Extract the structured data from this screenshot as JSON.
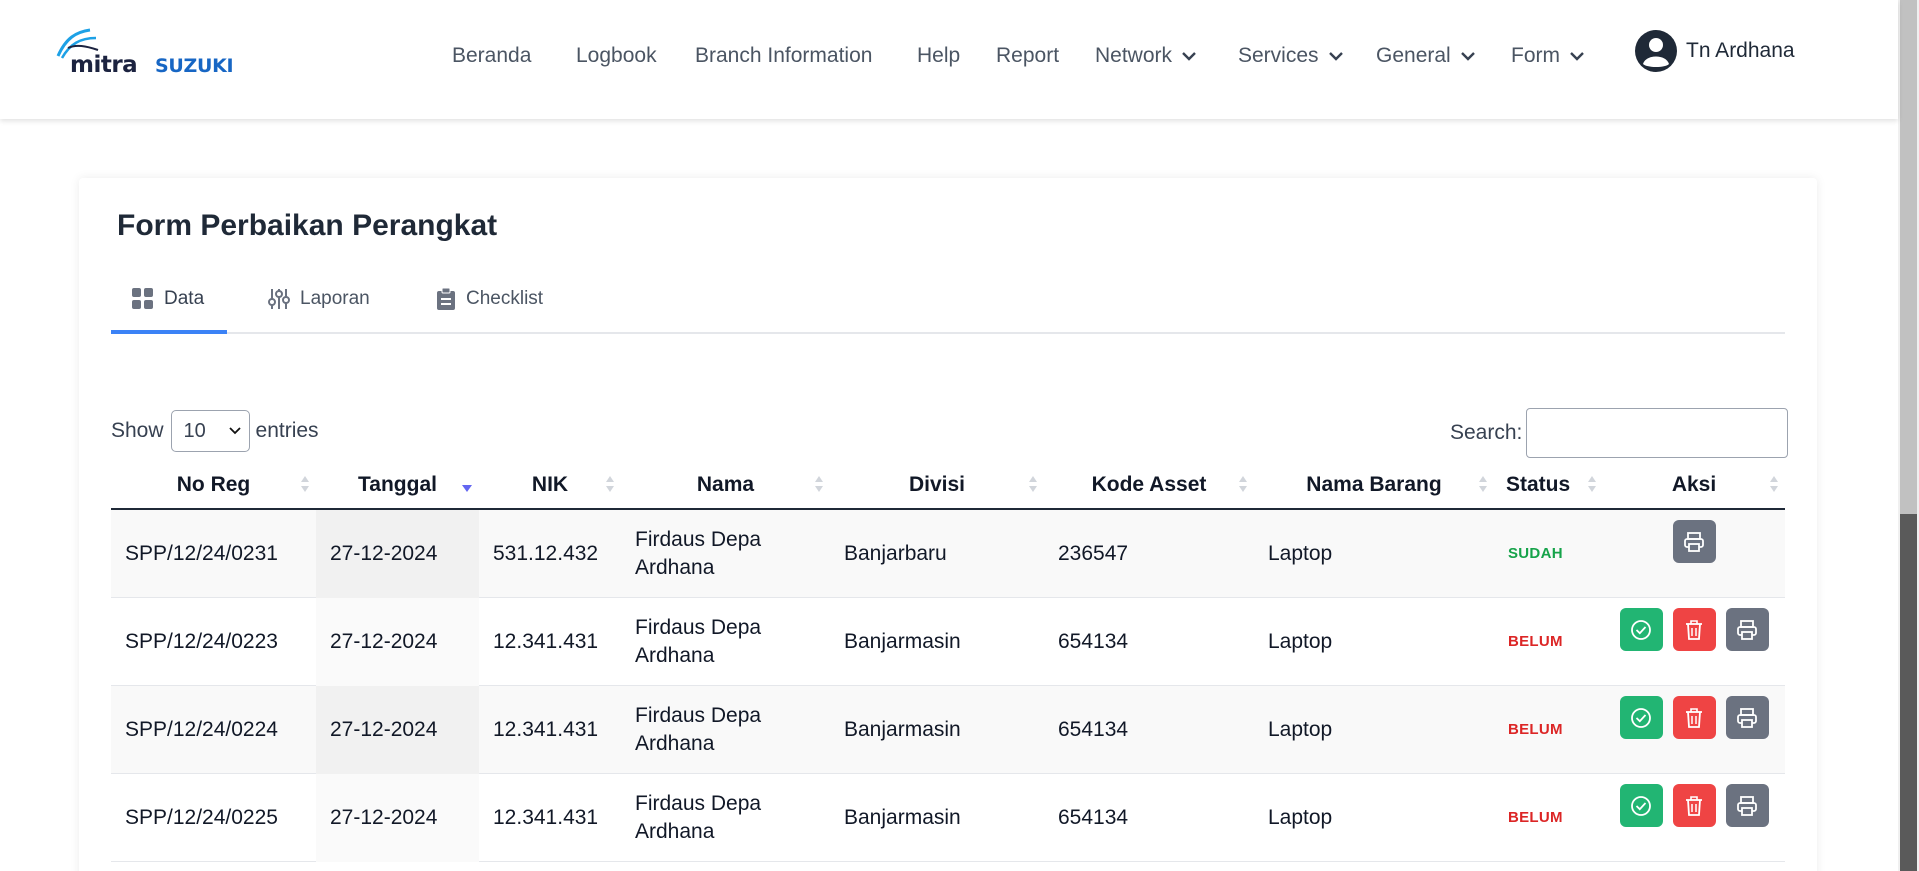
{
  "brand": {
    "part1": "mitra",
    "part2": "SUZUKI",
    "mark_color": "#1da1e6"
  },
  "nav": {
    "items": [
      {
        "label": "Beranda",
        "dropdown": false
      },
      {
        "label": "Logbook",
        "dropdown": false
      },
      {
        "label": "Branch Information",
        "dropdown": false
      },
      {
        "label": "Help",
        "dropdown": false
      },
      {
        "label": "Report",
        "dropdown": false
      },
      {
        "label": "Network",
        "dropdown": true
      },
      {
        "label": "Services",
        "dropdown": true
      },
      {
        "label": "General",
        "dropdown": true
      },
      {
        "label": "Form",
        "dropdown": true
      }
    ],
    "user": {
      "name": "Tn Ardhana",
      "icon": "user-circle-icon"
    }
  },
  "page": {
    "title": "Form Perbaikan Perangkat",
    "tabs": [
      {
        "label": "Data",
        "icon": "grid-icon",
        "active": true
      },
      {
        "label": "Laporan",
        "icon": "sliders-icon",
        "active": false
      },
      {
        "label": "Checklist",
        "icon": "clipboard-icon",
        "active": false
      }
    ]
  },
  "datatable": {
    "show_label": "Show",
    "entries_value": "10",
    "entries_label": "entries",
    "search_label": "Search:",
    "search_value": "",
    "columns": [
      "No Reg",
      "Tanggal",
      "NIK",
      "Nama",
      "Divisi",
      "Kode Asset",
      "Nama Barang",
      "Status",
      "Aksi"
    ],
    "sorted_column": "Tanggal",
    "rows": [
      {
        "no_reg": "SPP/12/24/0231",
        "tanggal": "27-12-2024",
        "nik": "531.12.432",
        "nama": "Firdaus Depa Ardhana",
        "divisi": "Banjarbaru",
        "kode_asset": "236547",
        "nama_barang": "Laptop",
        "status": "SUDAH",
        "actions": [
          "print"
        ]
      },
      {
        "no_reg": "SPP/12/24/0223",
        "tanggal": "27-12-2024",
        "nik": "12.341.431",
        "nama": "Firdaus Depa Ardhana",
        "divisi": "Banjarmasin",
        "kode_asset": "654134",
        "nama_barang": "Laptop",
        "status": "BELUM",
        "actions": [
          "approve",
          "delete",
          "print"
        ]
      },
      {
        "no_reg": "SPP/12/24/0224",
        "tanggal": "27-12-2024",
        "nik": "12.341.431",
        "nama": "Firdaus Depa Ardhana",
        "divisi": "Banjarmasin",
        "kode_asset": "654134",
        "nama_barang": "Laptop",
        "status": "BELUM",
        "actions": [
          "approve",
          "delete",
          "print"
        ]
      },
      {
        "no_reg": "SPP/12/24/0225",
        "tanggal": "27-12-2024",
        "nik": "12.341.431",
        "nama": "Firdaus Depa Ardhana",
        "divisi": "Banjarmasin",
        "kode_asset": "654134",
        "nama_barang": "Laptop",
        "status": "BELUM",
        "actions": [
          "approve",
          "delete",
          "print"
        ]
      }
    ]
  },
  "colors": {
    "accent": "#3b82f6",
    "status_done": "#16a34a",
    "status_pending": "#dc2626",
    "approve": "#22b573",
    "delete": "#ef4444",
    "print": "#6b7280"
  }
}
